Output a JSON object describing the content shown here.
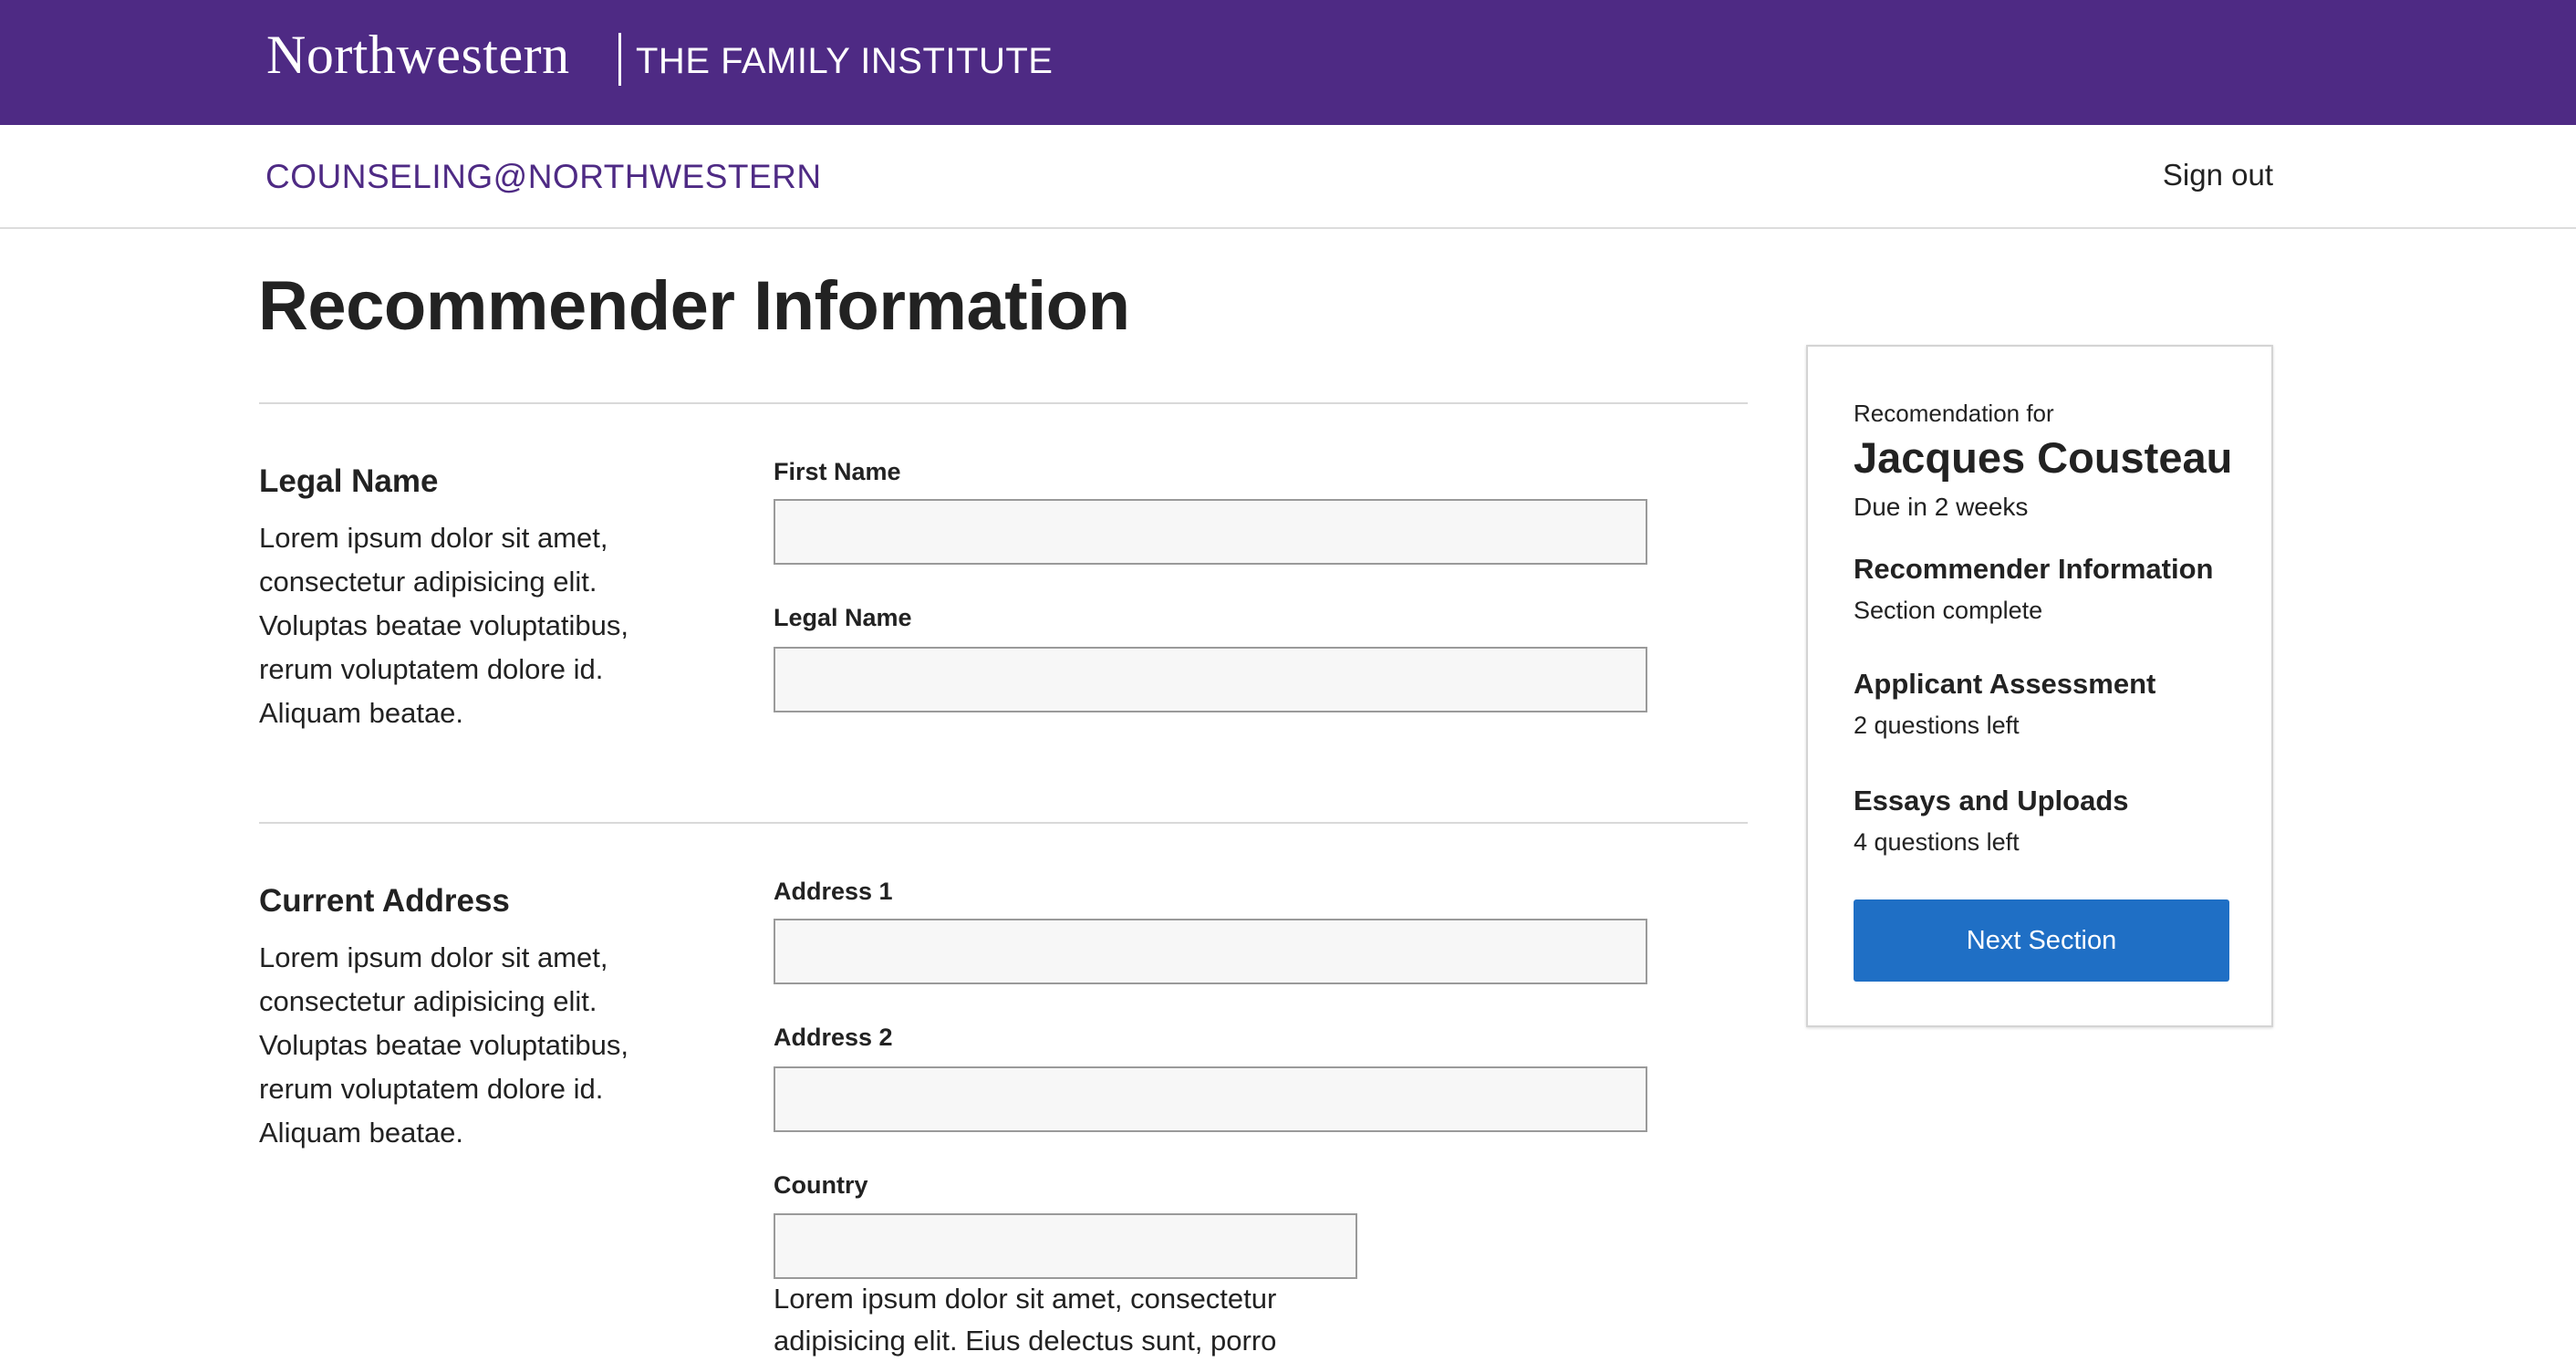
{
  "header": {
    "brand": "Northwestern",
    "subbrand": "THE FAMILY INSTITUTE"
  },
  "subnav": {
    "program": "COUNSELING@NORTHWESTERN",
    "signout": "Sign out"
  },
  "page": {
    "title": "Recommender Information"
  },
  "sections": [
    {
      "title": "Legal Name",
      "description": "Lorem ipsum dolor sit amet, consectetur adipisicing elit. Voluptas beatae voluptatibus, rerum voluptatem dolore id. Aliquam beatae.",
      "fields": [
        {
          "label": "First Name",
          "value": ""
        },
        {
          "label": "Legal Name",
          "value": ""
        }
      ]
    },
    {
      "title": "Current Address",
      "description": "Lorem ipsum dolor sit amet, consectetur adipisicing elit. Voluptas beatae voluptatibus, rerum voluptatem dolore id. Aliquam beatae.",
      "fields": [
        {
          "label": "Address 1",
          "value": ""
        },
        {
          "label": "Address 2",
          "value": ""
        },
        {
          "label": "Country",
          "value": "",
          "help": "Lorem ipsum dolor sit amet, consectetur adipisicing elit. Eius delectus sunt, porro"
        }
      ]
    }
  ],
  "sidebar": {
    "kicker": "Recomendation for",
    "name": "Jacques Cousteau",
    "due": "Due in 2 weeks",
    "steps": [
      {
        "title": "Recommender Information",
        "status": "Section complete"
      },
      {
        "title": "Applicant Assessment",
        "status": "2 questions left"
      },
      {
        "title": "Essays and Uploads",
        "status": "4 questions left"
      }
    ],
    "button": "Next Section"
  },
  "colors": {
    "brand_purple": "#4e2a84",
    "button_blue": "#1f6fc5"
  }
}
